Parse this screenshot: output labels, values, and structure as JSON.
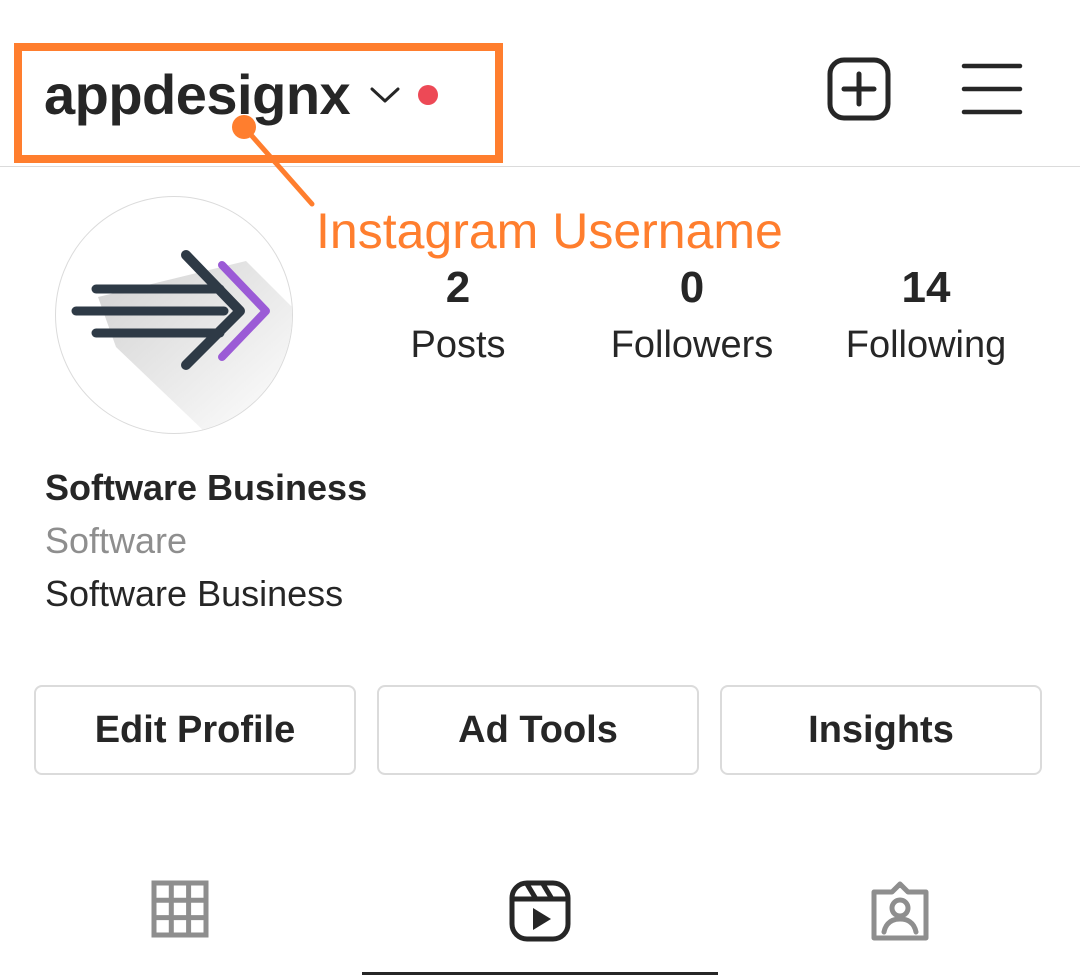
{
  "header": {
    "username": "appdesignx",
    "chevron_icon": "chevron-down-icon",
    "notification_dot_color": "#ed4956",
    "new_post_icon": "plus-square-icon",
    "menu_icon": "hamburger-menu-icon"
  },
  "annotation": {
    "label": "Instagram Username",
    "color": "#ff7e2e"
  },
  "profile": {
    "avatar_icon": "arrow-logo-icon",
    "stats": [
      {
        "count": "2",
        "label": "Posts"
      },
      {
        "count": "0",
        "label": "Followers"
      },
      {
        "count": "14",
        "label": "Following"
      }
    ],
    "name": "Software Business",
    "category": "Software",
    "bio": "Software Business"
  },
  "actions": {
    "edit_profile": "Edit Profile",
    "ad_tools": "Ad Tools",
    "insights": "Insights"
  },
  "tabs": [
    {
      "icon": "grid-icon",
      "active": false
    },
    {
      "icon": "reels-icon",
      "active": true
    },
    {
      "icon": "tagged-user-icon",
      "active": false
    }
  ]
}
